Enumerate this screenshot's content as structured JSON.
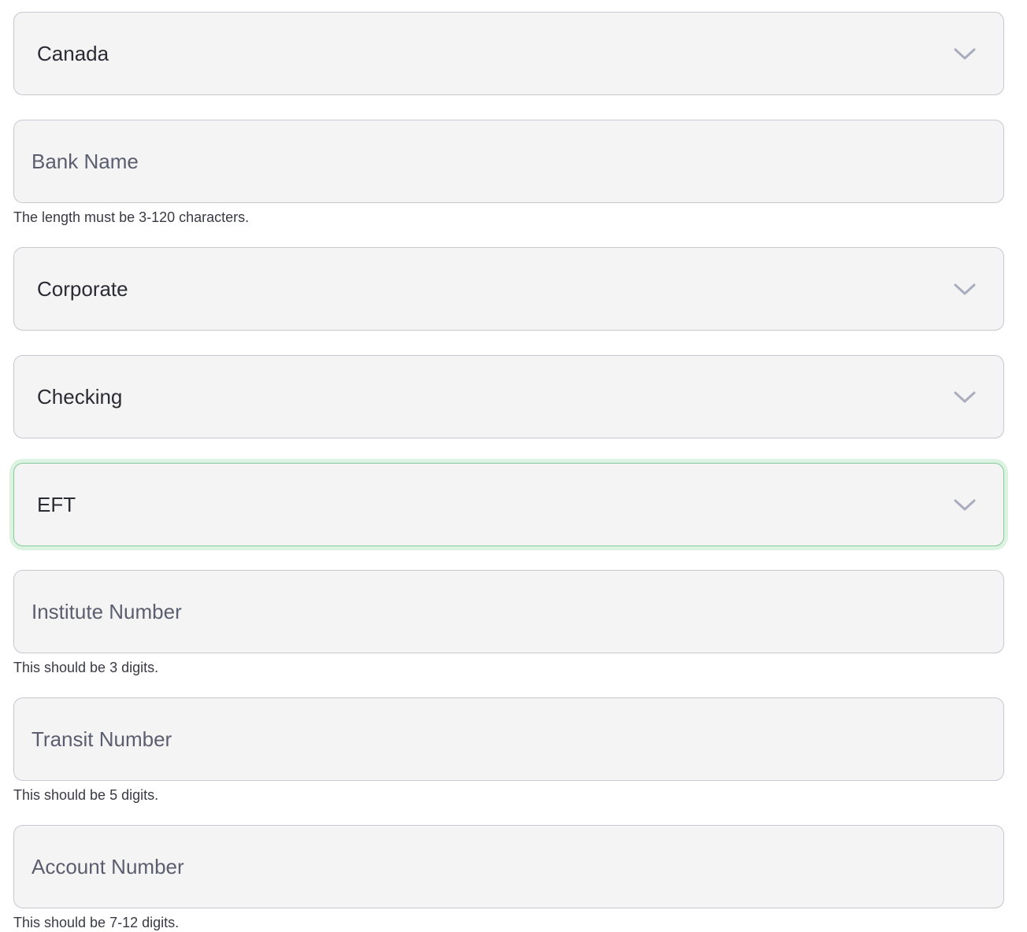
{
  "country_select": {
    "value": "Canada",
    "icon": "chevron-down-icon"
  },
  "bank_name": {
    "placeholder": "Bank Name",
    "help": "The length must be 3-120 characters."
  },
  "account_holder_type_select": {
    "value": "Corporate",
    "icon": "chevron-down-icon"
  },
  "account_type_select": {
    "value": "Checking",
    "icon": "chevron-down-icon"
  },
  "transfer_method_select": {
    "value": "EFT",
    "icon": "chevron-down-icon"
  },
  "institute_number": {
    "placeholder": "Institute Number",
    "help": "This should be 3 digits."
  },
  "transit_number": {
    "placeholder": "Transit Number",
    "help": "This should be 5 digits."
  },
  "account_number": {
    "placeholder": "Account Number",
    "help": "This should be 7-12 digits."
  },
  "colors": {
    "field_bg": "#f4f4f5",
    "field_border": "#c7c7d1",
    "focus_border": "#86c99a",
    "focus_ring": "#dcf3e2",
    "chevron": "#a9adbd"
  }
}
